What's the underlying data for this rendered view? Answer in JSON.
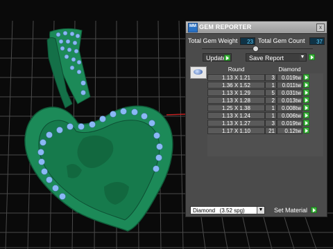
{
  "panel": {
    "title": "GEM REPORTER",
    "icon_text": "MM",
    "close_glyph": "x",
    "total_weight_label": "Total Gem Weight",
    "total_weight_value": "23",
    "total_count_label": "Total Gem Count",
    "total_count_value": "37",
    "update_label": "Update",
    "save_report_label": "Save Report",
    "dropdown_glyph": "▼"
  },
  "table": {
    "headers": [
      "Round",
      "Diamond"
    ],
    "rows": [
      {
        "size": "1.13 X 1.21",
        "count": "3",
        "weight": "0.019tw"
      },
      {
        "size": "1.36 X 1.52",
        "count": "1",
        "weight": "0.011tw"
      },
      {
        "size": "1.13 X 1.29",
        "count": "5",
        "weight": "0.031tw"
      },
      {
        "size": "1.13 X 1.28",
        "count": "2",
        "weight": "0.013tw"
      },
      {
        "size": "1.25 X 1.38",
        "count": "1",
        "weight": "0.008tw"
      },
      {
        "size": "1.13 X 1.24",
        "count": "1",
        "weight": "0.006tw"
      },
      {
        "size": "1.13 X 1.27",
        "count": "3",
        "weight": "0.019tw"
      },
      {
        "size": "1.17 X 1.10",
        "count": "21",
        "weight": "0.12tw"
      }
    ]
  },
  "material": {
    "selected": "Diamond   (3.52 spg)",
    "set_label": "Set Material"
  },
  "colors": {
    "model_green": "#1c8a58",
    "gem_blue": "#8ab8f5",
    "panel_bg": "#4b4b4b",
    "go_green": "#3fb43f"
  }
}
